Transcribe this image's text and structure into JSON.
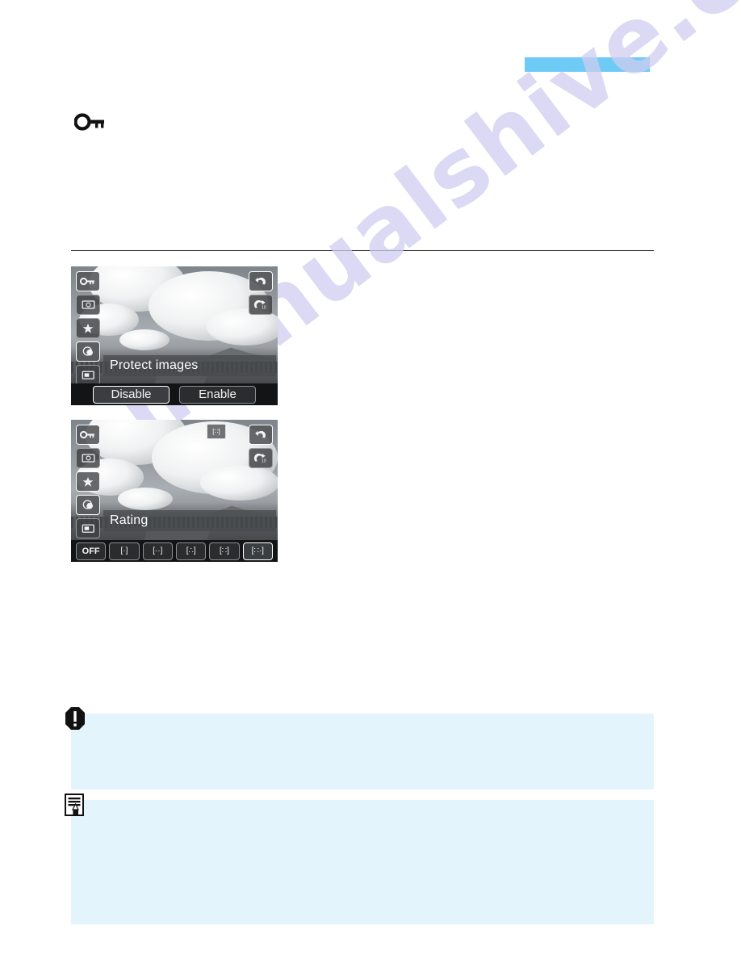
{
  "page": {
    "marker_bar_color": "#6ecbf5",
    "watermark_text": "manualshive.com",
    "watermark_color": "#cfcdf0",
    "section_icon": "key-icon"
  },
  "screens": [
    {
      "id": "protect-images",
      "title": "Protect images",
      "side_icons": [
        {
          "name": "protect-key-icon",
          "glyph": "O⌐"
        },
        {
          "name": "rotate-image-icon",
          "glyph": "▣"
        },
        {
          "name": "rating-star-icon",
          "glyph": "★"
        },
        {
          "name": "creative-filter-icon",
          "glyph": "◑"
        },
        {
          "name": "resize-image-icon",
          "glyph": "▧"
        }
      ],
      "right_icons": [
        {
          "name": "back-arrow-icon",
          "glyph": "↶"
        },
        {
          "name": "jump-10-icon",
          "glyph": "↷"
        }
      ],
      "options": [
        {
          "label": "Disable",
          "selected": true
        },
        {
          "label": "Enable",
          "selected": false
        }
      ]
    },
    {
      "id": "rating",
      "title": "Rating",
      "side_icons": [
        {
          "name": "protect-key-icon",
          "glyph": "O⌐"
        },
        {
          "name": "rotate-image-icon",
          "glyph": "▣"
        },
        {
          "name": "rating-star-icon",
          "glyph": "★"
        },
        {
          "name": "creative-filter-icon",
          "glyph": "◑"
        },
        {
          "name": "resize-image-icon",
          "glyph": "▧"
        }
      ],
      "right_icons": [
        {
          "name": "back-arrow-icon",
          "glyph": "↶"
        },
        {
          "name": "jump-10-icon",
          "glyph": "↷"
        }
      ],
      "top_badge": {
        "name": "rating-five-star-badge",
        "label": "[∷]"
      },
      "options": [
        {
          "label": "OFF",
          "selected": false
        },
        {
          "label": "[·]",
          "selected": false
        },
        {
          "label": "[··]",
          "selected": false
        },
        {
          "label": "[∴]",
          "selected": false
        },
        {
          "label": "[∷]",
          "selected": false
        },
        {
          "label": "[∷·]",
          "selected": true
        }
      ]
    }
  ],
  "info_boxes": [
    {
      "id": "caution-box",
      "icon": "caution-icon",
      "paragraphs": []
    },
    {
      "id": "note-box",
      "icon": "note-icon",
      "paragraphs": []
    }
  ]
}
